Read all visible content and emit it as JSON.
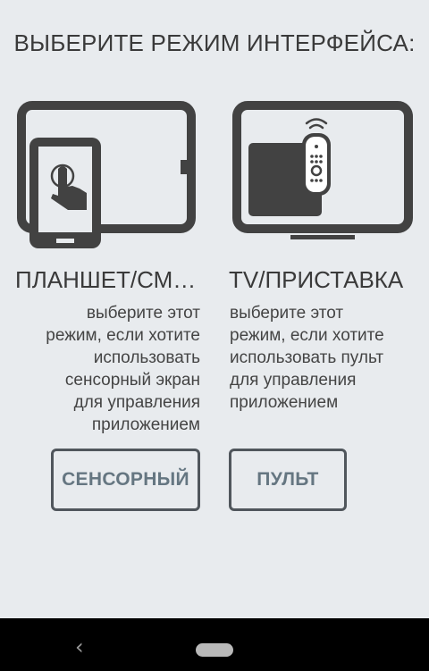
{
  "header": {
    "title": "ВЫБЕРИТЕ РЕЖИМ ИНТЕРФЕЙСА:"
  },
  "modes": {
    "tablet": {
      "title": "ПЛАНШЕТ/СМАРТФОН",
      "description": [
        "выберите этот",
        "режим, если хотите",
        "использовать",
        "сенсорный экран",
        "для управления",
        "приложением"
      ],
      "button_label": "СЕНСОРНЫЙ",
      "icon": "tablet-phone-touch-icon"
    },
    "tv": {
      "title": "TV/ПРИСТАВКА",
      "description": [
        "выберите этот",
        "режим, если хотите",
        "использовать пульт",
        "для управления",
        "приложением"
      ],
      "button_label": "ПУЛЬТ",
      "icon": "tv-settop-remote-icon"
    }
  },
  "navbar": {
    "back_icon": "back-chevron-icon",
    "home_icon": "home-pill-icon"
  },
  "colors": {
    "background": "#e8ebee",
    "icon": "#424242",
    "button_border": "#50565c",
    "button_text": "#657681"
  }
}
